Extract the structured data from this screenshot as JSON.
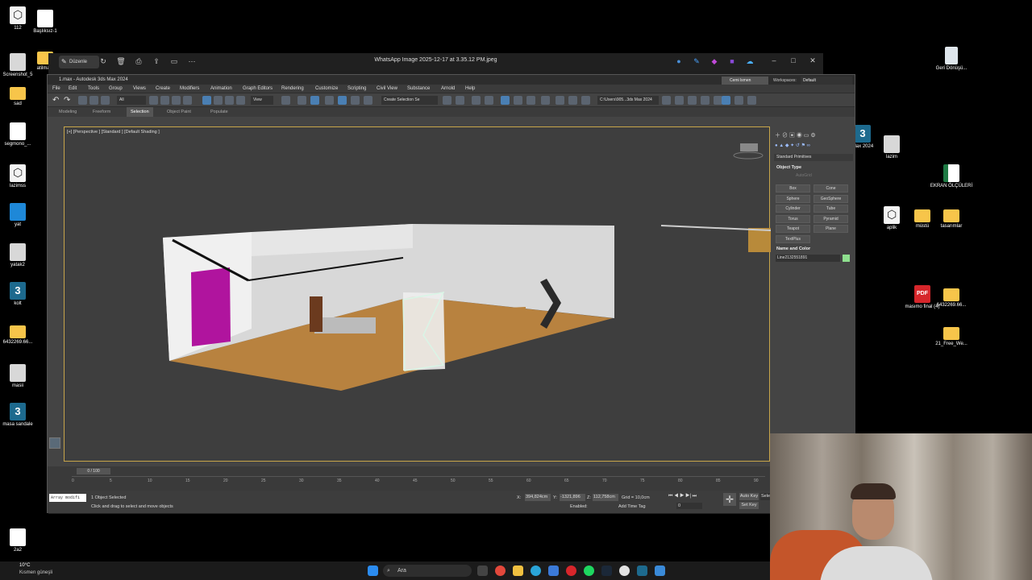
{
  "desktop": {
    "left_icons": [
      {
        "label": "112",
        "kind": "3ds"
      },
      {
        "label": "Screenshot_5",
        "kind": "thumb"
      },
      {
        "label": "sad",
        "kind": "folder"
      },
      {
        "label": "segmono_...",
        "kind": "doc"
      },
      {
        "label": "lazimss",
        "kind": "3ds"
      },
      {
        "label": "yat",
        "kind": "shield"
      },
      {
        "label": "yatak2",
        "kind": "thumb"
      },
      {
        "label": "kolt",
        "kind": "max"
      },
      {
        "label": "6432269.66...",
        "kind": "folder"
      },
      {
        "label": "masii",
        "kind": "thumb"
      },
      {
        "label": "masa sandale",
        "kind": "max"
      },
      {
        "label": "2a2",
        "kind": "doc"
      }
    ],
    "second_col_icons": [
      {
        "label": "Başlıksız-1",
        "kind": "doc"
      },
      {
        "label": "atilmadi",
        "kind": "folder"
      }
    ],
    "right_icons": [
      {
        "label": "Geri Dönüşü...",
        "kind": "bin"
      },
      {
        "label": "Max 2024",
        "kind": "max"
      },
      {
        "label": "lazim",
        "kind": "thumb"
      },
      {
        "label": "EKRAN ÖLÇÜLERİ",
        "kind": "xls"
      },
      {
        "label": "aplik",
        "kind": "3ds"
      },
      {
        "label": "müstü",
        "kind": "folder"
      },
      {
        "label": "tasarımlar",
        "kind": "folder"
      },
      {
        "label": "masımo final (4)",
        "kind": "pdf"
      },
      {
        "label": "6432269.66...",
        "kind": "folder"
      },
      {
        "label": "21_Free_We...",
        "kind": "folder"
      }
    ],
    "max_glyph": "3"
  },
  "viewer": {
    "edit_label": "Düzenle",
    "title": "WhatsApp Image 2025-12-17 at 3.35.12 PM.jpeg"
  },
  "max": {
    "title": "1.max - Autodesk 3ds Max 2024",
    "menu": [
      "File",
      "Edit",
      "Tools",
      "Group",
      "Views",
      "Create",
      "Modifiers",
      "Animation",
      "Graph Editors",
      "Rendering",
      "Customize",
      "Scripting",
      "Civil View",
      "Substance",
      "Arnold",
      "Help"
    ],
    "user": "Cemi lsmen",
    "workspace_label": "Workspaces:",
    "workspace_value": "Default",
    "selection_filter": "All",
    "view_dropdown": "View",
    "selection_set": "Create Selection Se",
    "path": "C:\\Users\\905...3ds Max 2024",
    "ribbon_tabs": [
      "Modeling",
      "Freeform",
      "Selection",
      "Object Paint",
      "Populate"
    ],
    "viewport_label": "[+] [Perspective ] [Standard ] [Default Shading ]",
    "command_panel": {
      "category": "Standard Primitives",
      "object_type_header": "Object Type",
      "autogrid": "AutoGrid",
      "buttons": [
        "Box",
        "Cone",
        "Sphere",
        "GeoSphere",
        "Cylinder",
        "Tube",
        "Torus",
        "Pyramid",
        "Teapot",
        "Plane",
        "TextPlus"
      ],
      "name_color_header": "Name and Color",
      "object_name": "Line2132551891",
      "object_color": "#8fe08f"
    },
    "timeline": {
      "frame": "0 / 100",
      "ticks": [
        "0",
        "5",
        "10",
        "15",
        "20",
        "25",
        "30",
        "35",
        "40",
        "45",
        "50",
        "55",
        "60",
        "65",
        "70",
        "75",
        "80",
        "85",
        "90"
      ]
    },
    "status": {
      "maxscript": "Array modifi",
      "selected": "1 Object Selected",
      "prompt": "Click and drag to select and move objects",
      "x": "394,824cm",
      "y": "-1321,896",
      "z": "112,758cm",
      "grid": "Grid = 10,0cm",
      "enabled": "Enabled:",
      "add_time_tag": "Add Time Tag",
      "auto_key": "Auto Key",
      "set_key": "Set Key",
      "selected_btn": "Selec",
      "frame_field": "0"
    }
  },
  "taskbar": {
    "weather_temp": "10°C",
    "weather_desc": "Kısmen güneşli",
    "search": "Ara"
  }
}
